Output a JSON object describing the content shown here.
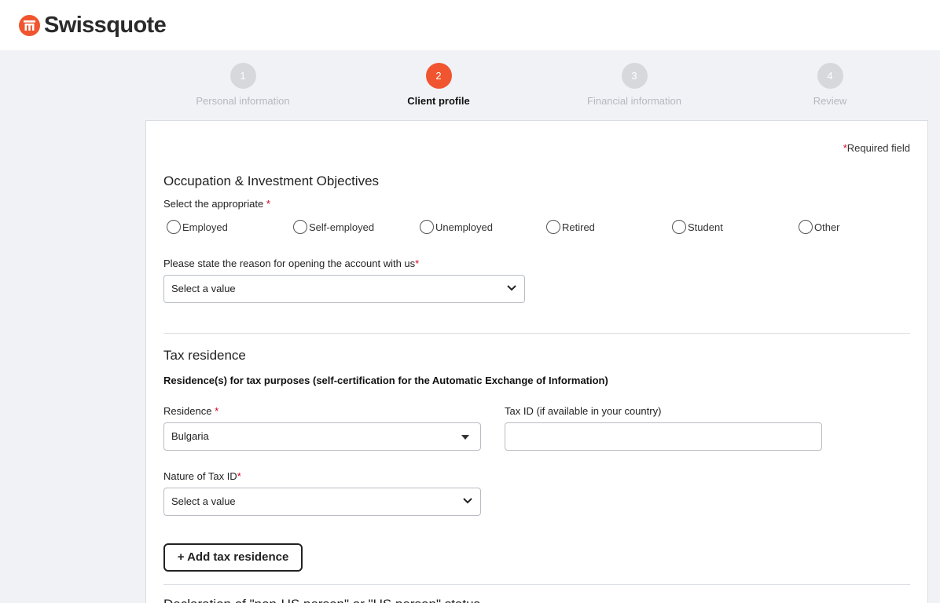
{
  "header": {
    "brand": "Swissquote",
    "brand_color": "#f0552f"
  },
  "stepper": {
    "steps": [
      {
        "number": "1",
        "label": "Personal information",
        "state": "inactive"
      },
      {
        "number": "2",
        "label": "Client profile",
        "state": "active"
      },
      {
        "number": "3",
        "label": "Financial information",
        "state": "inactive"
      },
      {
        "number": "4",
        "label": "Review",
        "state": "inactive"
      }
    ]
  },
  "form": {
    "required_marker": "*",
    "required_note": "Required field",
    "occupation": {
      "title": "Occupation & Investment Objectives",
      "select_label": "Select the appropriate",
      "options": [
        "Employed",
        "Self-employed",
        "Unemployed",
        "Retired",
        "Student",
        "Other"
      ],
      "reason_label": "Please state the reason for opening the account with us",
      "reason_value": "Select a value"
    },
    "tax": {
      "title": "Tax residence",
      "subtitle": "Residence(s) for tax purposes (self-certification for the Automatic Exchange of Information)",
      "residence_label": "Residence",
      "residence_value": "Bulgaria",
      "tax_id_label": "Tax ID (if available in your country)",
      "tax_id_value": "",
      "nature_label": "Nature of Tax ID",
      "nature_value": "Select a value",
      "add_button": "+ Add tax residence"
    },
    "next_section_partial": "Declaration of \"non-US person\" or \"US person\" status"
  }
}
